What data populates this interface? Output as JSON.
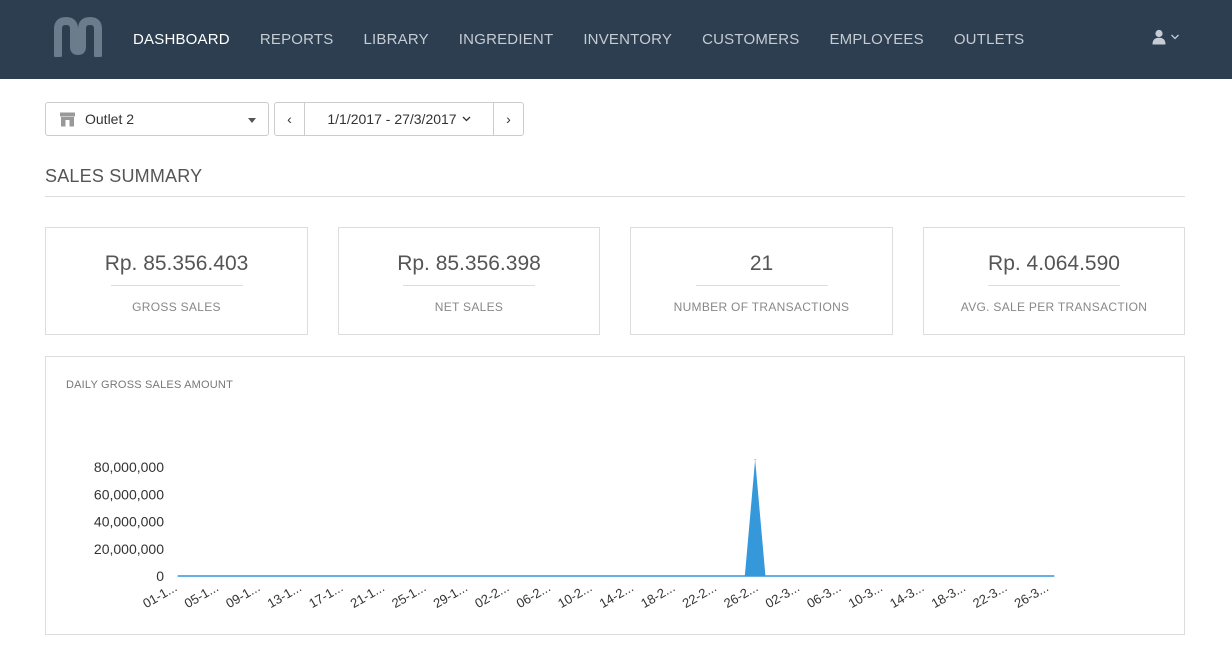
{
  "nav": {
    "items": [
      {
        "label": "DASHBOARD",
        "active": true
      },
      {
        "label": "REPORTS",
        "active": false
      },
      {
        "label": "LIBRARY",
        "active": false
      },
      {
        "label": "INGREDIENT",
        "active": false
      },
      {
        "label": "INVENTORY",
        "active": false
      },
      {
        "label": "CUSTOMERS",
        "active": false
      },
      {
        "label": "EMPLOYEES",
        "active": false
      },
      {
        "label": "OUTLETS",
        "active": false
      }
    ],
    "user_icon": "user-icon",
    "logo": "brand-logo"
  },
  "filters": {
    "outlet": "Outlet 2",
    "outlet_icon": "store-icon",
    "date_range": "1/1/2017 - 27/3/2017",
    "prev_label": "‹",
    "next_label": "›"
  },
  "summary": {
    "title": "SALES SUMMARY",
    "cards": [
      {
        "value": "Rp. 85.356.403",
        "label": "GROSS SALES"
      },
      {
        "value": "Rp. 85.356.398",
        "label": "NET SALES"
      },
      {
        "value": "21",
        "label": "NUMBER OF TRANSACTIONS"
      },
      {
        "value": "Rp. 4.064.590",
        "label": "AVG. SALE PER TRANSACTION"
      }
    ]
  },
  "colors": {
    "topbar": "#2c3e50",
    "accent": "#3498db"
  },
  "chart": {
    "title": "DAILY GROSS SALES AMOUNT"
  },
  "chart_data": {
    "type": "area",
    "title": "DAILY GROSS SALES AMOUNT",
    "xlabel": "",
    "ylabel": "",
    "ylim": [
      0,
      80000000
    ],
    "yticks": [
      "80,000,000",
      "60,000,000",
      "40,000,000",
      "20,000,000",
      "0"
    ],
    "ytick_values": [
      80000000,
      60000000,
      40000000,
      20000000,
      0
    ],
    "x_tick_labels": [
      "01-1...",
      "05-1...",
      "09-1...",
      "13-1...",
      "17-1...",
      "21-1...",
      "25-1...",
      "29-1...",
      "02-2...",
      "06-2...",
      "10-2...",
      "14-2...",
      "18-2...",
      "22-2...",
      "26-2...",
      "02-3...",
      "06-3...",
      "10-3...",
      "14-3...",
      "18-3...",
      "22-3...",
      "26-3..."
    ],
    "series": [
      {
        "values": [
          0,
          0,
          0,
          0,
          0,
          0,
          0,
          0,
          0,
          0,
          0,
          0,
          0,
          0,
          0,
          0,
          0,
          0,
          0,
          0,
          0,
          0,
          0,
          0,
          0,
          0,
          0,
          0,
          0,
          0,
          0,
          0,
          0,
          0,
          0,
          0,
          0,
          0,
          0,
          0,
          0,
          0,
          0,
          0,
          0,
          0,
          0,
          0,
          0,
          0,
          0,
          0,
          0,
          0,
          0,
          0,
          85356403,
          0,
          0,
          0,
          0,
          0,
          0,
          0,
          0,
          0,
          0,
          0,
          0,
          0,
          0,
          0,
          0,
          0,
          0,
          0,
          0,
          0,
          0,
          0,
          0,
          0,
          0,
          0,
          0,
          0
        ]
      }
    ],
    "grid": false,
    "legend": "none"
  }
}
